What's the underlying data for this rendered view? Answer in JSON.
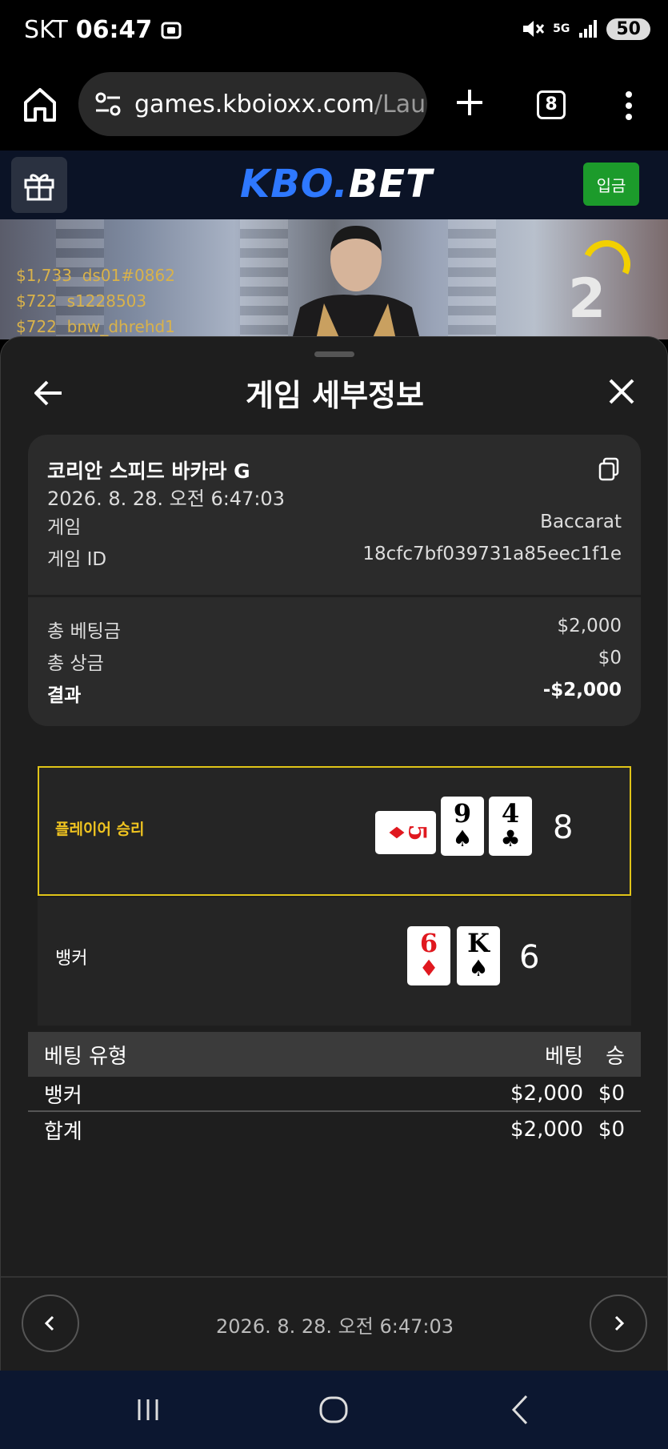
{
  "status_bar": {
    "carrier": "SKT",
    "time": "06:47",
    "network": "5G",
    "battery": "50"
  },
  "browser": {
    "url_host": "games.kboioxx.com",
    "url_path": "/Launc",
    "tab_count": "8"
  },
  "site": {
    "logo_part1": "KBO.",
    "logo_part2": "BET",
    "deposit_label": "입금"
  },
  "video": {
    "bet_feed": [
      {
        "amount": "$1,733",
        "user": "ds01#0862"
      },
      {
        "amount": "$722",
        "user": "s1228503"
      },
      {
        "amount": "$722",
        "user": "bnw_dhrehd1"
      }
    ],
    "round_number": "2"
  },
  "sheet": {
    "title": "게임 세부정보",
    "game_name": "코리안 스피드 바카라 G",
    "datetime": "2026. 8. 28. 오전 6:47:03",
    "game_label": "게임",
    "game_value": "Baccarat",
    "game_id_label": "게임 ID",
    "game_id_value": "18cfc7bf039731a85eec1f1e",
    "total_bet_label": "총 베팅금",
    "total_bet_value": "$2,000",
    "total_win_label": "총 상금",
    "total_win_value": "$0",
    "result_label": "결과",
    "result_value": "-$2,000"
  },
  "hands": {
    "player": {
      "label": "플레이어 승리",
      "total": "8",
      "cards": [
        {
          "rank": "5",
          "suit": "♦",
          "color": "red",
          "orientation": "sideways"
        },
        {
          "rank": "9",
          "suit": "♠",
          "color": "black",
          "orientation": "upright"
        },
        {
          "rank": "4",
          "suit": "♣",
          "color": "black",
          "orientation": "upright"
        }
      ]
    },
    "banker": {
      "label": "뱅커",
      "total": "6",
      "cards": [
        {
          "rank": "6",
          "suit": "♦",
          "color": "red",
          "orientation": "upright"
        },
        {
          "rank": "K",
          "suit": "♠",
          "color": "black",
          "orientation": "upright"
        }
      ]
    }
  },
  "bet_table": {
    "headers": [
      "베팅 유형",
      "베팅",
      "승"
    ],
    "rows": [
      [
        "뱅커",
        "$2,000",
        "$0"
      ],
      [
        "합계",
        "$2,000",
        "$0"
      ]
    ]
  },
  "footer": {
    "datetime": "2026. 8. 28. 오전 6:47:03"
  },
  "colors": {
    "accent_gold": "#e0c418",
    "deposit_green": "#1c9b2b",
    "logo_blue": "#2e78ff",
    "card_red": "#e0181f"
  }
}
